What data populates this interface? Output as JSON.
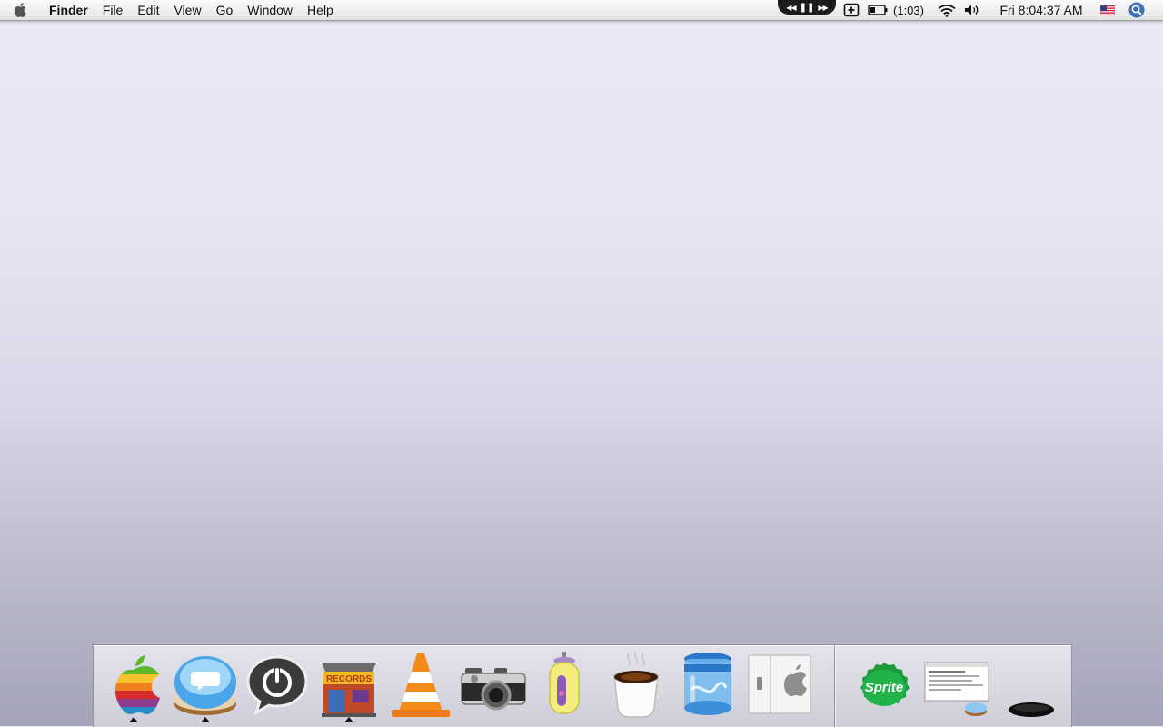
{
  "menubar": {
    "app_name": "Finder",
    "menus": [
      "File",
      "Edit",
      "View",
      "Go",
      "Window",
      "Help"
    ],
    "battery_time": "(1:03)",
    "clock": "Fri 8:04:37 AM"
  },
  "dock": {
    "apps": [
      {
        "name": "apple-rainbow",
        "running": true
      },
      {
        "name": "chat-bubble-button",
        "running": true
      },
      {
        "name": "power-speech",
        "running": false
      },
      {
        "name": "records-store",
        "running": true
      },
      {
        "name": "vlc-cone",
        "running": false
      },
      {
        "name": "camera",
        "running": false
      },
      {
        "name": "capsule",
        "running": false
      },
      {
        "name": "coffee-cup",
        "running": false
      },
      {
        "name": "glass-jar",
        "running": false
      },
      {
        "name": "switch-panel",
        "running": false
      }
    ],
    "docs": [
      {
        "name": "sprite-cap",
        "label": "Sprite"
      },
      {
        "name": "document-preview"
      },
      {
        "name": "black-disc"
      }
    ]
  },
  "colors": {
    "desktop_top": "#e9e8f4",
    "desktop_bottom": "#a4a3b7"
  }
}
